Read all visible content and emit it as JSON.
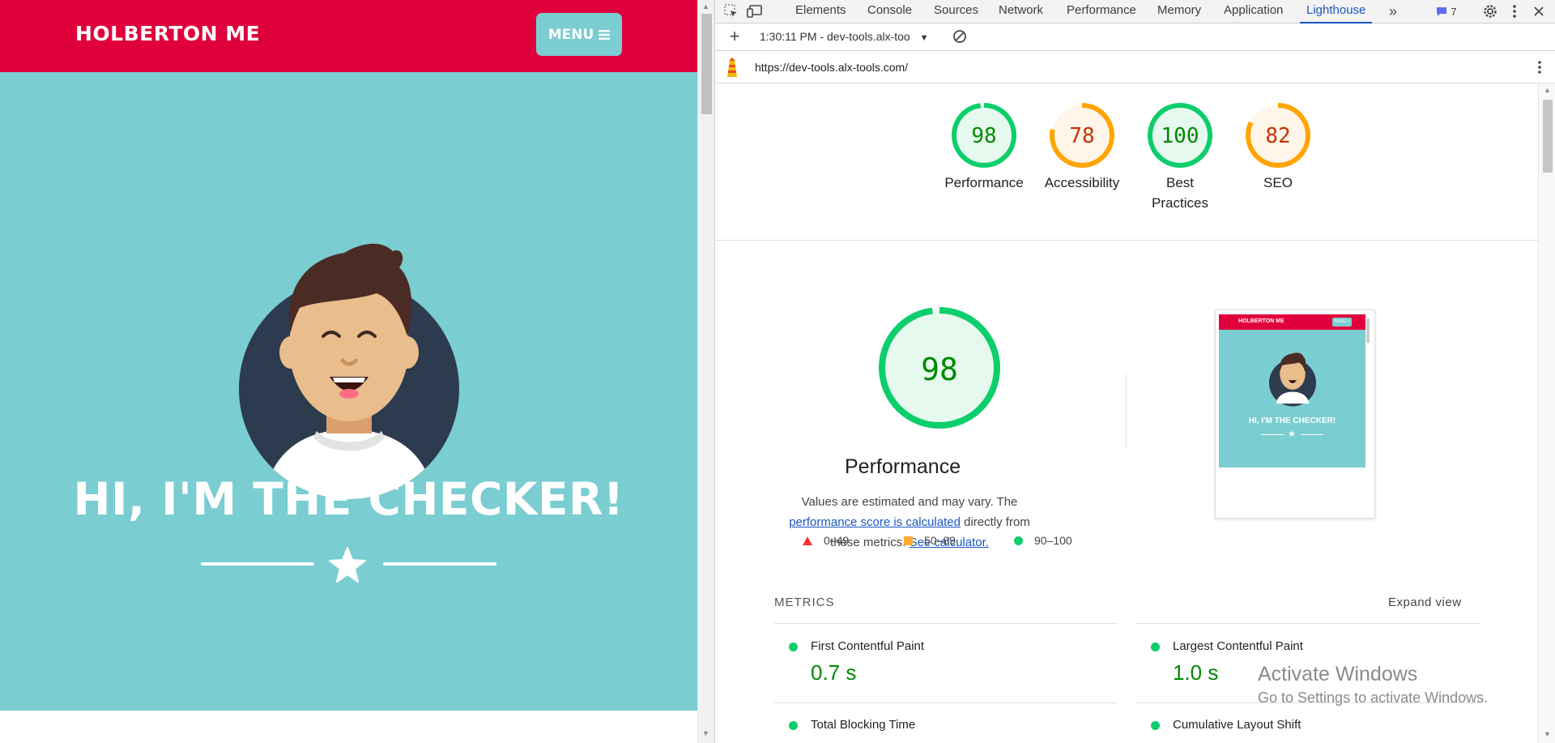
{
  "site": {
    "brand": "HOLBERTON ME",
    "menu_label": "MENU",
    "hero_title": "HI, I'M THE CHECKER!",
    "colors": {
      "header": "#e0003c",
      "hero": "#7acdd1",
      "avatar_bg": "#2d3b4e"
    }
  },
  "devtools": {
    "tabs": [
      "Elements",
      "Console",
      "Sources",
      "Network",
      "Performance",
      "Memory",
      "Application",
      "Lighthouse"
    ],
    "active_tab": "Lighthouse",
    "issues_count": "7",
    "report_select": "1:30:11 PM - dev-tools.alx-too",
    "report_url": "https://dev-tools.alx-tools.com/",
    "scores": [
      {
        "label": "Performance",
        "value": "98",
        "status": "pass"
      },
      {
        "label": "Accessibility",
        "value": "78",
        "status": "average"
      },
      {
        "label": "Best Practices",
        "value": "100",
        "status": "pass"
      },
      {
        "label": "SEO",
        "value": "82",
        "status": "average"
      }
    ],
    "performance": {
      "score": "98",
      "title": "Performance",
      "desc_before": "Values are estimated and may vary. The ",
      "desc_link1": "performance score is calculated",
      "desc_middle": " directly from these metrics. ",
      "desc_link2": "See calculator."
    },
    "legend": [
      {
        "range": "0–49",
        "color": "#ff3333"
      },
      {
        "range": "50–89",
        "color": "#ffaa33"
      },
      {
        "range": "90–100",
        "color": "#0cce6b"
      }
    ],
    "thumbnail": {
      "brand": "HOLBERTON ME",
      "menu": "MENU ≡",
      "title": "HI, I'M THE CHECKER!"
    },
    "metrics_heading": "METRICS",
    "expand_view": "Expand view",
    "metrics": [
      {
        "name": "First Contentful Paint",
        "value": "0.7 s"
      },
      {
        "name": "Largest Contentful Paint",
        "value": "1.0 s"
      },
      {
        "name": "Total Blocking Time",
        "value": ""
      },
      {
        "name": "Cumulative Layout Shift",
        "value": ""
      }
    ],
    "watermark": {
      "title": "Activate Windows",
      "subtitle": "Go to Settings to activate Windows."
    },
    "colors": {
      "pass": "#0cce6b",
      "pass_text": "#008800",
      "average": "#ffa400",
      "average_text": "#c33300",
      "link": "#1a56c2"
    }
  }
}
